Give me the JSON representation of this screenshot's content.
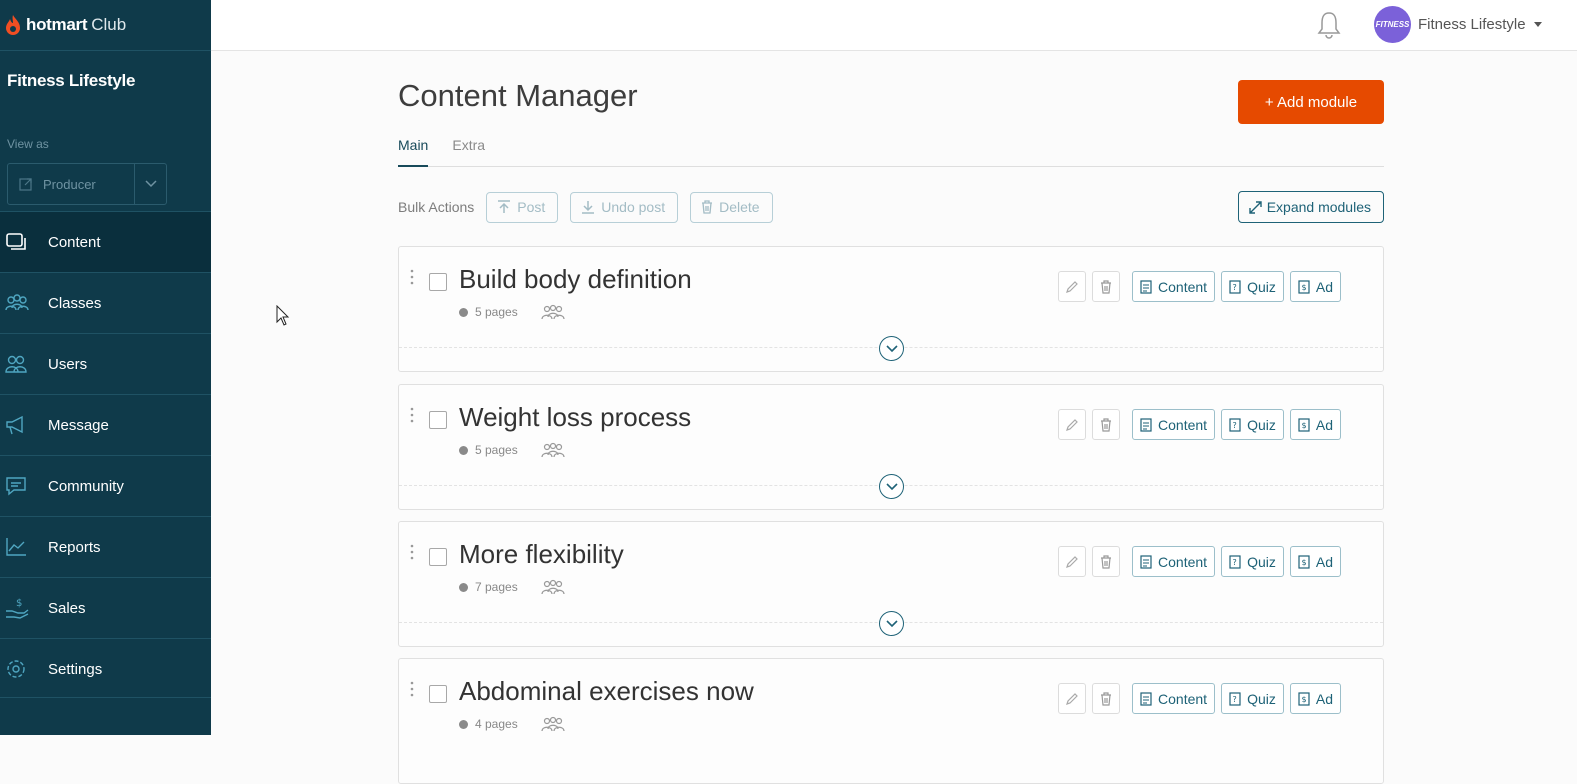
{
  "brand": {
    "logo": "hotmart",
    "club": "Club"
  },
  "sidebar": {
    "club_title": "Fitness Lifestyle",
    "view_as_label": "View as",
    "view_as_value": "Producer",
    "items": [
      {
        "label": "Content",
        "icon": "content-icon",
        "active": true
      },
      {
        "label": "Classes",
        "icon": "classes-icon"
      },
      {
        "label": "Users",
        "icon": "users-icon"
      },
      {
        "label": "Message",
        "icon": "megaphone-icon"
      },
      {
        "label": "Community",
        "icon": "chat-icon"
      },
      {
        "label": "Reports",
        "icon": "chart-icon"
      },
      {
        "label": "Sales",
        "icon": "dollar-hand-icon"
      },
      {
        "label": "Settings",
        "icon": "gear-icon"
      }
    ]
  },
  "topbar": {
    "account_name": "Fitness Lifestyle",
    "avatar_text": "FITNESS"
  },
  "main": {
    "title": "Content Manager",
    "add_module_label": "+ Add module",
    "tabs": [
      {
        "label": "Main",
        "active": true
      },
      {
        "label": "Extra"
      }
    ],
    "bulk": {
      "label": "Bulk Actions",
      "post": "Post",
      "undo_post": "Undo post",
      "delete": "Delete",
      "expand": "Expand modules"
    },
    "action_labels": {
      "content": "Content",
      "quiz": "Quiz",
      "ad": "Ad"
    },
    "modules": [
      {
        "title": "Build body definition",
        "pages": "5 pages"
      },
      {
        "title": "Weight loss process",
        "pages": "5 pages"
      },
      {
        "title": "More flexibility",
        "pages": "7 pages"
      },
      {
        "title": "Abdominal exercises now",
        "pages": "4 pages"
      }
    ]
  },
  "colors": {
    "sidebar": "#0f3a4a",
    "accent": "#e64a00",
    "primary": "#1e6277"
  }
}
